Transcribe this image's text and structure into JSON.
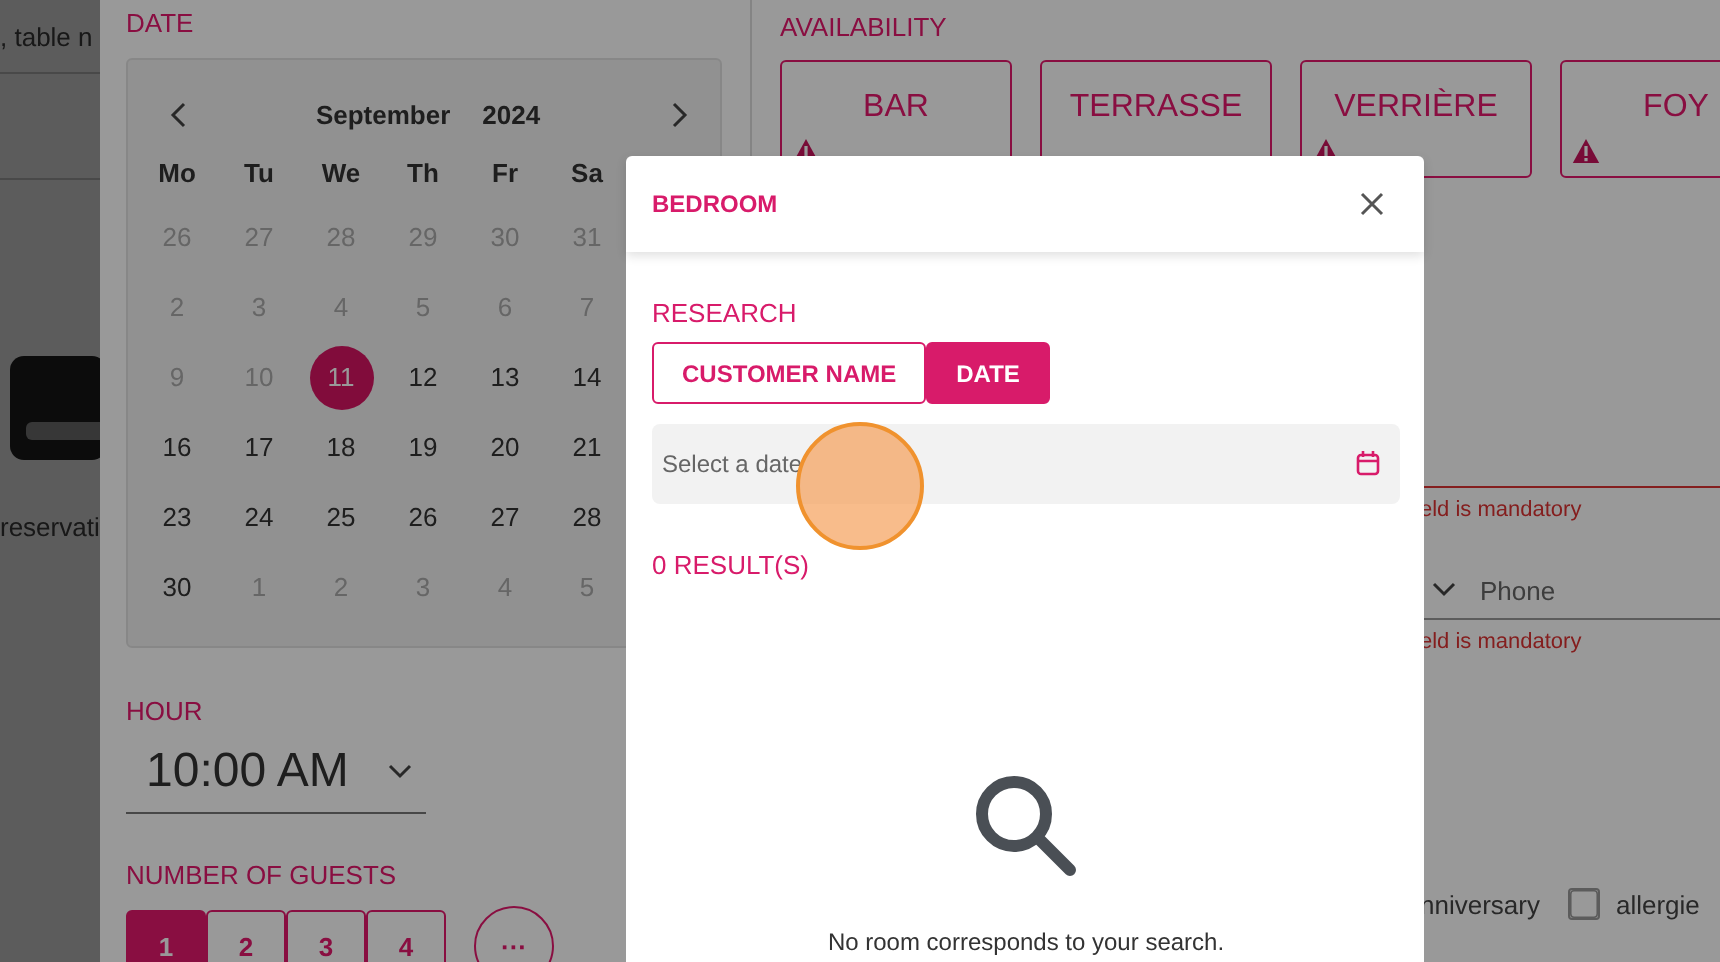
{
  "background_page": {
    "search_text": ", table n",
    "empty_text": "reservati"
  },
  "date": {
    "label": "DATE",
    "calendar": {
      "month": "September",
      "year": "2024",
      "weekdays": [
        "Mo",
        "Tu",
        "We",
        "Th",
        "Fr",
        "Sa"
      ],
      "weeks": [
        [
          {
            "day": "26",
            "disabled": true,
            "selected": false
          },
          {
            "day": "27",
            "disabled": true,
            "selected": false
          },
          {
            "day": "28",
            "disabled": true,
            "selected": false
          },
          {
            "day": "29",
            "disabled": true,
            "selected": false
          },
          {
            "day": "30",
            "disabled": true,
            "selected": false
          },
          {
            "day": "31",
            "disabled": true,
            "selected": false
          }
        ],
        [
          {
            "day": "2",
            "disabled": true,
            "selected": false
          },
          {
            "day": "3",
            "disabled": true,
            "selected": false
          },
          {
            "day": "4",
            "disabled": true,
            "selected": false
          },
          {
            "day": "5",
            "disabled": true,
            "selected": false
          },
          {
            "day": "6",
            "disabled": true,
            "selected": false
          },
          {
            "day": "7",
            "disabled": true,
            "selected": false
          }
        ],
        [
          {
            "day": "9",
            "disabled": true,
            "selected": false
          },
          {
            "day": "10",
            "disabled": true,
            "selected": false
          },
          {
            "day": "11",
            "disabled": false,
            "selected": true
          },
          {
            "day": "12",
            "disabled": false,
            "selected": false
          },
          {
            "day": "13",
            "disabled": false,
            "selected": false
          },
          {
            "day": "14",
            "disabled": false,
            "selected": false
          }
        ],
        [
          {
            "day": "16",
            "disabled": false,
            "selected": false
          },
          {
            "day": "17",
            "disabled": false,
            "selected": false
          },
          {
            "day": "18",
            "disabled": false,
            "selected": false
          },
          {
            "day": "19",
            "disabled": false,
            "selected": false
          },
          {
            "day": "20",
            "disabled": false,
            "selected": false
          },
          {
            "day": "21",
            "disabled": false,
            "selected": false
          }
        ],
        [
          {
            "day": "23",
            "disabled": false,
            "selected": false
          },
          {
            "day": "24",
            "disabled": false,
            "selected": false
          },
          {
            "day": "25",
            "disabled": false,
            "selected": false
          },
          {
            "day": "26",
            "disabled": false,
            "selected": false
          },
          {
            "day": "27",
            "disabled": false,
            "selected": false
          },
          {
            "day": "28",
            "disabled": false,
            "selected": false
          }
        ],
        [
          {
            "day": "30",
            "disabled": false,
            "selected": false
          },
          {
            "day": "1",
            "disabled": true,
            "selected": false
          },
          {
            "day": "2",
            "disabled": true,
            "selected": false
          },
          {
            "day": "3",
            "disabled": true,
            "selected": false
          },
          {
            "day": "4",
            "disabled": true,
            "selected": false
          },
          {
            "day": "5",
            "disabled": true,
            "selected": false
          }
        ]
      ]
    }
  },
  "hour": {
    "label": "HOUR",
    "value": "10:00 AM"
  },
  "guests": {
    "label": "NUMBER OF GUESTS",
    "options": [
      {
        "label": "1",
        "selected": true
      },
      {
        "label": "2",
        "selected": false
      },
      {
        "label": "3",
        "selected": false
      },
      {
        "label": "4",
        "selected": false
      }
    ],
    "more": "···"
  },
  "availability": {
    "label": "AVAILABILITY",
    "areas": [
      {
        "name": "BAR",
        "warning": true
      },
      {
        "name": "TERRASSE",
        "warning": false
      },
      {
        "name": "VERRIÈRE",
        "warning": true
      },
      {
        "name": "FOY",
        "warning": true
      }
    ]
  },
  "form": {
    "errors": [
      "eld is mandatory",
      "eld is mandatory"
    ],
    "phone_placeholder": "Phone",
    "checkboxes": [
      {
        "kind": "label",
        "label": "nniversary"
      },
      {
        "kind": "checkbox",
        "label": "allergie",
        "checked": false
      }
    ]
  },
  "modal": {
    "title": "BEDROOM",
    "research_label": "RESEARCH",
    "tabs": [
      {
        "label": "CUSTOMER NAME",
        "selected": false
      },
      {
        "label": "DATE",
        "selected": true
      }
    ],
    "date_placeholder": "Select a date",
    "results": "0 RESULT(S)",
    "empty_text": "No room corresponds to your search."
  }
}
